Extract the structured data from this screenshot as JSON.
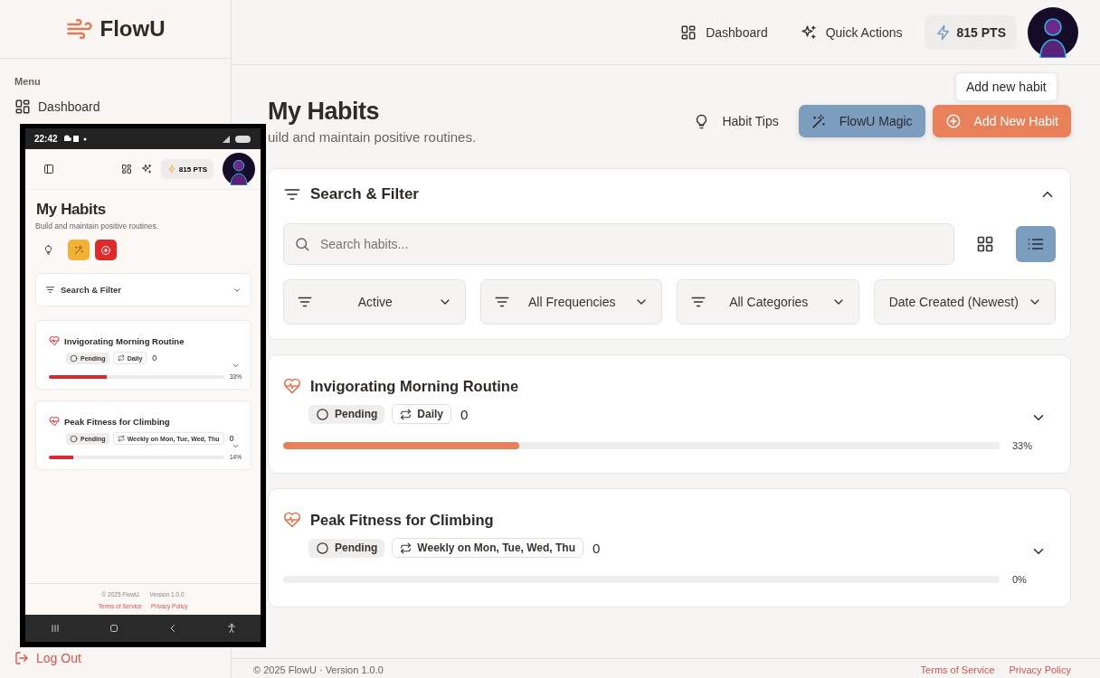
{
  "sidebar": {
    "logo": "FlowU",
    "section_label": "Menu",
    "items": [
      {
        "label": "Dashboard",
        "selected": false
      }
    ],
    "logout": "Log Out"
  },
  "topbar": {
    "links": [
      {
        "kind": "dashboard",
        "label": "Dashboard"
      },
      {
        "kind": "sparkle",
        "label": "Quick Actions"
      }
    ],
    "points": "815 PTS"
  },
  "tooltip": "Add new habit",
  "page": {
    "title": "My Habits",
    "subtitle": "uild and maintain positive routines.",
    "actions": [
      {
        "kind": "ghost",
        "label": "Habit Tips"
      },
      {
        "kind": "magic",
        "label": "FlowU Magic"
      },
      {
        "kind": "primary",
        "label": "Add New Habit"
      }
    ]
  },
  "filter": {
    "title": "Search & Filter",
    "expanded": true,
    "search_placeholder": "Search habits...",
    "views": [
      {
        "kind": "grid",
        "selected": false
      },
      {
        "kind": "list",
        "selected": true
      }
    ],
    "dropdowns": [
      {
        "kind": "filter",
        "label": "Active"
      },
      {
        "kind": "filter",
        "label": "All Frequencies"
      },
      {
        "kind": "filter",
        "label": "All Categories"
      },
      {
        "kind": "sort",
        "label": "Date Created (Newest)"
      }
    ]
  },
  "habits": [
    {
      "title": "Invigorating Morning Routine",
      "status": "Pending",
      "frequency": "Daily",
      "count": "0",
      "expanded": false,
      "level": 0.33,
      "percent": "33%"
    },
    {
      "title": "Peak Fitness for Climbing",
      "status": "Pending",
      "frequency": "Weekly on Mon, Tue, Wed, Thu",
      "count": "0",
      "expanded": false,
      "level": 0,
      "percent": "0%"
    }
  ],
  "footer": {
    "copyright": "© 2025 FlowU · Version 1.0.0",
    "links": [
      "Terms of Service",
      "Privacy Policy"
    ]
  },
  "phone": {
    "time": "22:42",
    "points": "815 PTS",
    "title": "My Habits",
    "subtitle": "Build and maintain positive routines.",
    "filter_title": "Search & Filter",
    "filter_expanded": false,
    "habits": [
      {
        "title": "Invigorating Morning Routine",
        "status": "Pending",
        "frequency": "Daily",
        "count": "0",
        "expanded": false,
        "level": 0.33,
        "percent": "33%"
      },
      {
        "title": "Peak Fitness for Climbing",
        "status": "Pending",
        "frequency": "Weekly on Mon, Tue, Wed, Thu",
        "count": "0",
        "expanded": false,
        "level": 0.14,
        "percent": "14%"
      }
    ],
    "footer": {
      "copyright": "© 2025 FlowU.",
      "version": "Version 1.0.0",
      "links": [
        "Terms of Service",
        "Privacy Policy"
      ]
    }
  }
}
